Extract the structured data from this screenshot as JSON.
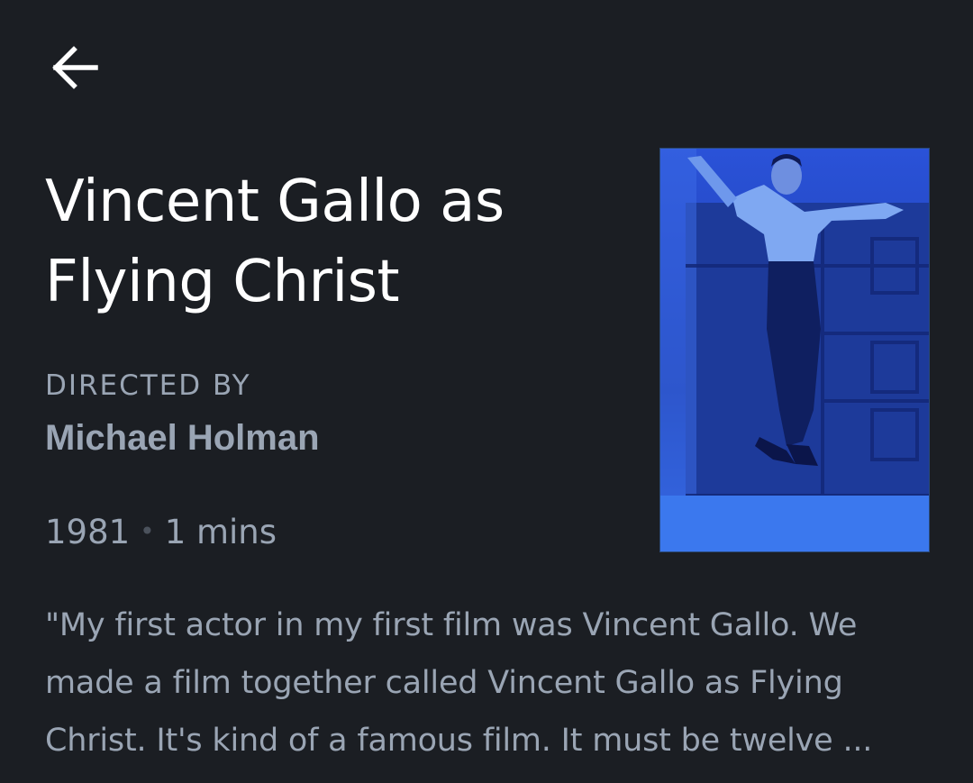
{
  "header": {
    "back_icon": "arrow-left-icon"
  },
  "film": {
    "title": "Vincent Gallo as Flying Christ",
    "directed_label": "DIRECTED BY",
    "director": "Michael Holman",
    "year": "1981",
    "separator": "•",
    "duration": "1 mins",
    "synopsis": "\"My first actor in my first film was Vincent Gallo. We made a film together called Vincent Gallo as Flying Christ. It's kind of a famous film. It must be twelve ..."
  },
  "colors": {
    "background": "#1b1e23",
    "title_text": "#ffffff",
    "secondary_text": "#9aa5b4",
    "poster_tint": "#1b3fb0"
  }
}
